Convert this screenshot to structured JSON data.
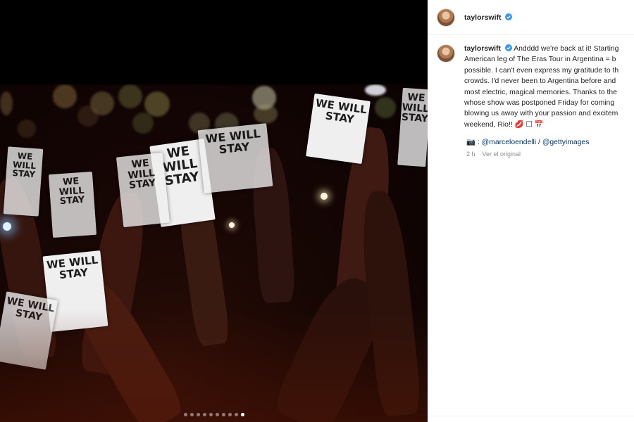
{
  "post": {
    "username": "taylorswift",
    "verified": true,
    "caption_lines": [
      "Andddd we're back at it! Starting",
      "American leg of The Eras Tour in Argentina = b",
      "possible. I can't even express my gratitude to th",
      "crowds. I'd never been to Argentina before and",
      "most electric, magical memories. Thanks to the",
      "whose show was postponed Friday for coming",
      "blowing us away with your passion and excitem",
      "weekend, Rio!! 💋 ☐ 📅"
    ],
    "credit_prefix": "📷 : ",
    "credit_user1": "@marceloendelli",
    "credit_sep": " / ",
    "credit_user2": "@gettyimages",
    "time_ago": "2 h",
    "see_original": "Ver el original"
  },
  "media": {
    "signs": [
      "WE WILL STAY",
      "WE WILL STAY",
      "WE WILL STAY",
      "WE WILL STAY",
      "WE WILL STAY",
      "WE WILL STAY",
      "WE WILL STAY",
      "WE WILL STAY",
      "WE WILL STAY"
    ],
    "carousel_count": 10,
    "carousel_active_index": 9
  },
  "colors": {
    "link": "#00376b",
    "verified": "#3897f0",
    "muted": "#8e8e8e"
  }
}
